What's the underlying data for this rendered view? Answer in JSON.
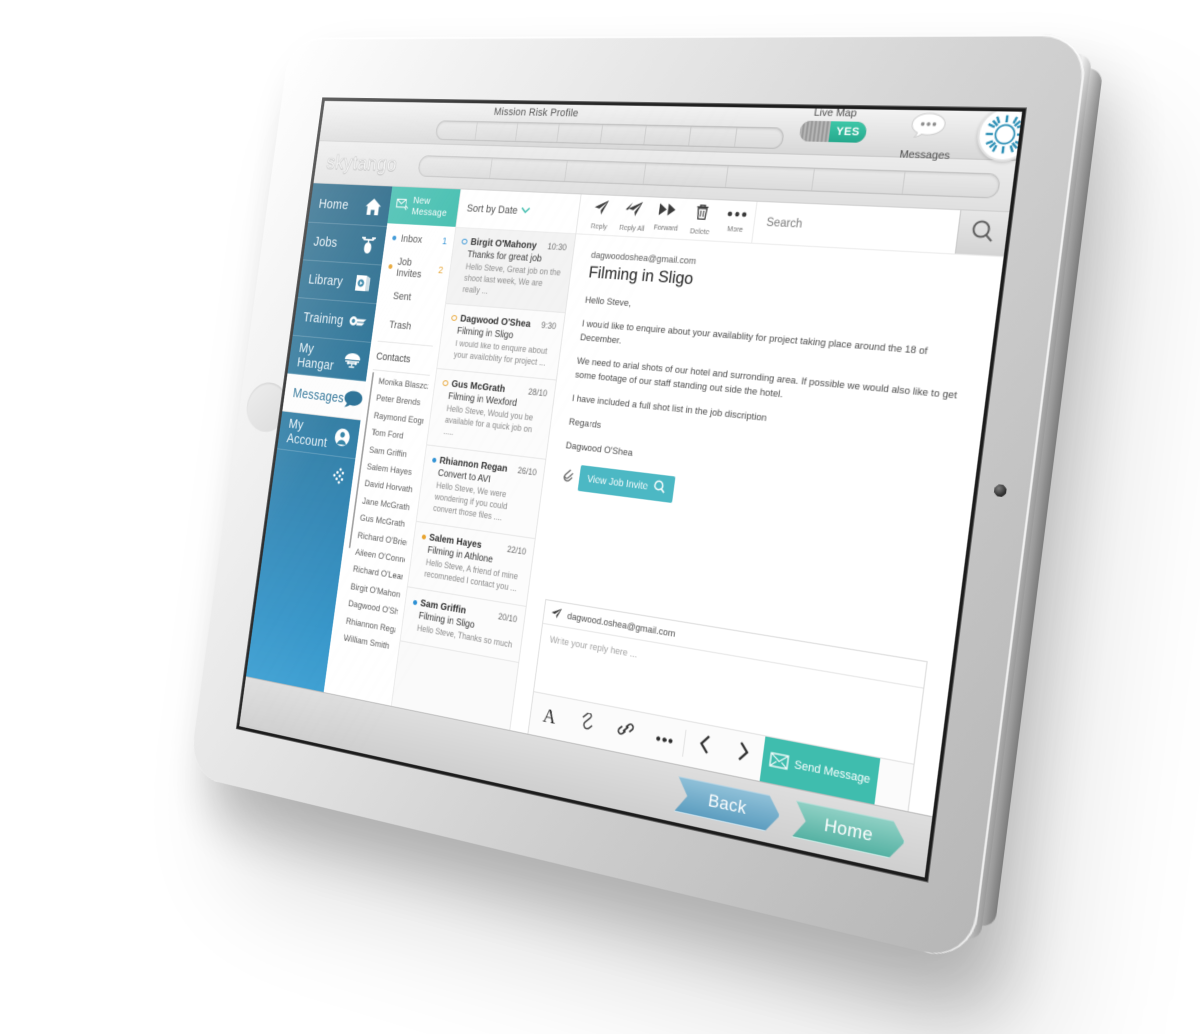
{
  "device": {
    "chrome": {
      "risk_label": "Mission Risk Profile",
      "live_map_label": "Live Map",
      "toggle_value": "YES",
      "messages_label": "Messages",
      "bubble_icon": "speech-bubble-icon",
      "logo_icon": "skytango-orb-icon"
    },
    "footer": {
      "back_label": "Back",
      "home_label": "Home"
    }
  },
  "app": {
    "brand": "skytango",
    "sidebar": {
      "items": [
        {
          "label": "Home",
          "icon": "house-icon",
          "active": false
        },
        {
          "label": "Jobs",
          "icon": "drone-bag-icon",
          "active": false
        },
        {
          "label": "Library",
          "icon": "book-play-icon",
          "active": false
        },
        {
          "label": "Training",
          "icon": "wings-icon",
          "active": false
        },
        {
          "label": "My Hangar",
          "icon": "hangar-drone-icon",
          "active": false
        },
        {
          "label": "Messages",
          "icon": "chat-dots-icon",
          "active": true
        },
        {
          "label": "My Account",
          "icon": "user-icon",
          "active": false
        }
      ],
      "collapse_icon": "chevron-left-collapse-icon"
    },
    "folders": {
      "new_message_label": "New Message",
      "new_message_icon": "compose-envelope-icon",
      "items": [
        {
          "label": "Inbox",
          "count": "1",
          "dot": "#2a8fd4"
        },
        {
          "label": "Job Invites",
          "count": "2",
          "dot": "#e8a22a"
        },
        {
          "label": "Sent",
          "count": "",
          "dot": ""
        },
        {
          "label": "Trash",
          "count": "",
          "dot": ""
        }
      ],
      "contacts_label": "Contacts",
      "contacts": [
        "Monika Blaszcz ...",
        "Peter Brends",
        "Raymond Eogn",
        "Tom Ford",
        "Sam Griffin",
        "Salem Hayes",
        "David Horvath",
        "Jane McGrath",
        "Gus McGrath",
        "Richard O'Brien",
        "Aileen O'Connor",
        "Richard O'Leary",
        "Birgit O'Mahony",
        "Dagwood  O'Shea",
        "Rhiannon Regan",
        "William Smith"
      ]
    },
    "message_list": {
      "sort_label": "Sort by Date",
      "sort_icon": "chevron-down-icon",
      "items": [
        {
          "from": "Birgit O'Mahony",
          "date": "10:30",
          "subject": "Thanks for great job",
          "preview": "Hello Steve, Great job on the shoot last week, We are really ...",
          "dot_color": "#2a8fd4",
          "unread": false,
          "read_bg": true
        },
        {
          "from": "Dagwood  O'Shea",
          "date": "9:30",
          "subject": "Filming in Sligo",
          "preview": "I would like to enquire about your availoblity for project ...",
          "dot_color": "#e8a22a",
          "unread": false,
          "read_bg": false
        },
        {
          "from": "Gus McGrath",
          "date": "28/10",
          "subject": "Filming in Wexford",
          "preview": "Hello Steve, Would you be available for a quick job on .....",
          "dot_color": "#e8a22a",
          "unread": false,
          "read_bg": false
        },
        {
          "from": "Rhiannon Regan",
          "date": "26/10",
          "subject": "Convert to AVI",
          "preview": "Hello Steve, We were wondering if you could convert those files ....",
          "dot_color": "#2a8fd4",
          "unread": true,
          "read_bg": false
        },
        {
          "from": "Salem Hayes",
          "date": "22/10",
          "subject": "Filming in Athlone",
          "preview": "Hello Steve, A friend of mine recomneded I contact you ...",
          "dot_color": "#e8a22a",
          "unread": true,
          "read_bg": false
        },
        {
          "from": "Sam Griffin",
          "date": "20/10",
          "subject": "Filming in Sligo",
          "preview": "Hello Steve, Thanks so much",
          "dot_color": "#2a8fd4",
          "unread": true,
          "read_bg": false
        }
      ]
    },
    "reader": {
      "toolbar": [
        {
          "label": "Reply",
          "icon": "reply-paper-plane-icon"
        },
        {
          "label": "Reply All",
          "icon": "reply-all-paper-plane-icon"
        },
        {
          "label": "Forward",
          "icon": "forward-double-arrow-icon"
        },
        {
          "label": "Delete",
          "icon": "trash-icon"
        },
        {
          "label": "More",
          "icon": "ellipsis-icon"
        }
      ],
      "search_placeholder": "Search",
      "search_icon": "magnifier-icon",
      "from_address": "dagwoodoshea@gmail.com",
      "subject": "Filming in Sligo",
      "paragraphs": [
        "Hello Steve,",
        "I would like to enquire about your availablity for project taking place around the 18 of December.",
        "We need to arial shots of our hotel and surronding area. If possible we would also like to get some footage of our staff standing out side the hotel.",
        "I have included a full shot list in the job discription",
        "Regards",
        "Dagwood O'Shea"
      ],
      "attachment_icon": "paperclip-icon",
      "job_invite_label": "View Job Invite",
      "job_invite_icon": "magnifier-icon"
    },
    "composer": {
      "to_icon": "paper-plane-icon",
      "to_address": "dagwood.oshea@gmail.com",
      "placeholder": "Write your reply here ...",
      "tools": [
        {
          "icon": "font-A-icon",
          "name": "format-text"
        },
        {
          "icon": "paperclip-icon",
          "name": "attach"
        },
        {
          "icon": "link-icon",
          "name": "insert-link"
        },
        {
          "icon": "ellipsis-icon",
          "name": "more"
        }
      ],
      "prev_icon": "chevron-left-icon",
      "next_icon": "chevron-right-icon",
      "send_icon": "envelope-icon",
      "send_label": "Send  Message"
    }
  },
  "colors": {
    "teal": "#3fbdae",
    "sidebar_top": "#1b5e80",
    "sidebar_bottom": "#3a9ed2",
    "invite_blue": "#4cb8c4",
    "unread_blue": "#2a8fd4",
    "invite_orange": "#e8a22a"
  }
}
